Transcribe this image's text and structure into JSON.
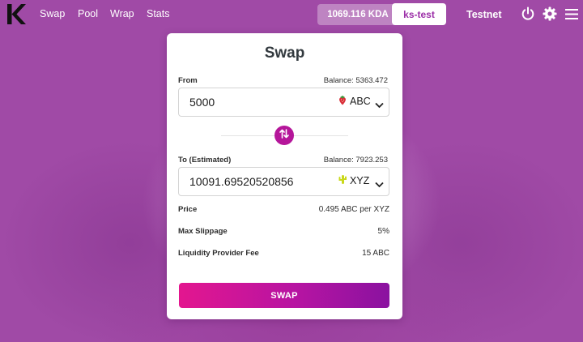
{
  "nav": {
    "links": [
      "Swap",
      "Pool",
      "Wrap",
      "Stats"
    ],
    "kda_balance": "1069.116 KDA",
    "account": "ks-test",
    "network": "Testnet",
    "icons": [
      "logo-k-icon",
      "power-icon",
      "gear-icon",
      "hamburger-menu-icon"
    ]
  },
  "swap": {
    "title": "Swap",
    "from": {
      "label": "From",
      "balance": "Balance: 5363.472",
      "amount": "5000",
      "token": "ABC",
      "token_icon": "strawberry-icon"
    },
    "to": {
      "label": "To (Estimated)",
      "balance": "Balance: 7923.253",
      "amount": "10091.69520520856",
      "token": "XYZ",
      "token_icon": "cactus-icon"
    },
    "info": [
      {
        "label": "Price",
        "value": "0.495 ABC per XYZ"
      },
      {
        "label": "Max Slippage",
        "value": "5%"
      },
      {
        "label": "Liquidity Provider Fee",
        "value": "15 ABC"
      }
    ],
    "button_label": "SWAP"
  },
  "colors": {
    "background": "#a04aa6",
    "accent": "#b5169a",
    "button_gradient_start": "#e3168f",
    "button_gradient_end": "#8a12a0",
    "account_text": "#9b2ea7"
  }
}
